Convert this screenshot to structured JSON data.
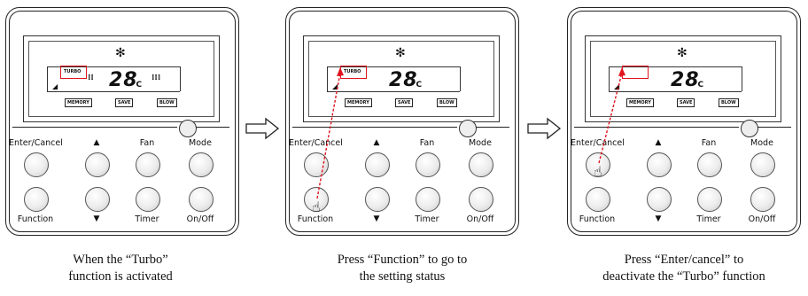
{
  "lcd": {
    "turbo_label": "TURBO",
    "temperature": "28",
    "unit": "°C",
    "chips": [
      "MEMORY",
      "SAVE",
      "BLOW"
    ]
  },
  "buttons": {
    "enter_cancel": "Enter/Cancel",
    "fan": "Fan",
    "mode": "Mode",
    "function": "Function",
    "timer": "Timer",
    "on_off": "On/Off",
    "up": "▲",
    "down": "▼"
  },
  "panels": [
    {
      "caption_lines": [
        "When the “Turbo”",
        "function is activated"
      ]
    },
    {
      "caption_lines": [
        "Press “Function” to go to",
        "the setting status"
      ]
    },
    {
      "caption_lines": [
        "Press “Enter/cancel” to",
        "deactivate the “Turbo” function"
      ]
    }
  ],
  "colors": {
    "highlight": "#e0141e",
    "pointer": "#e0141e"
  }
}
